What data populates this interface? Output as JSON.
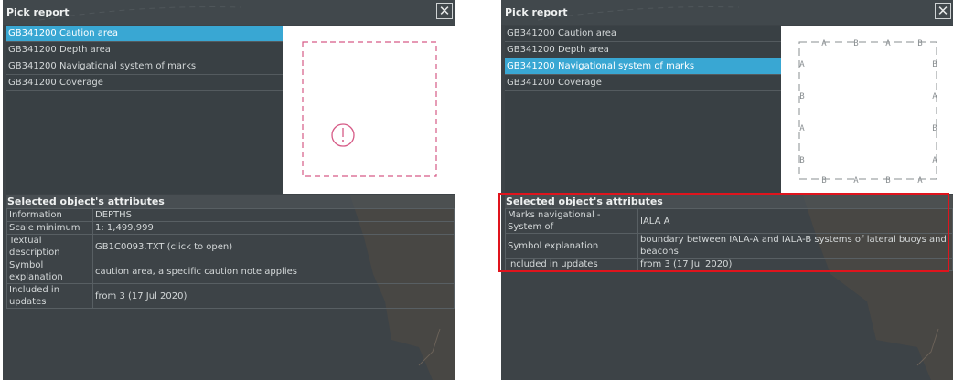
{
  "left": {
    "title": "Pick report",
    "close_icon": "close-icon",
    "items": [
      {
        "label": "GB341200 Caution area",
        "selected": true
      },
      {
        "label": "GB341200 Depth area",
        "selected": false
      },
      {
        "label": "GB341200 Navigational system of marks",
        "selected": false
      },
      {
        "label": "GB341200 Coverage",
        "selected": false
      }
    ],
    "preview_symbol": "caution-exclamation-icon",
    "attributes_title": "Selected object's attributes",
    "attributes": [
      {
        "name": "Information",
        "value": "DEPTHS"
      },
      {
        "name": "Scale minimum",
        "value": "1: 1,499,999"
      },
      {
        "name": "Textual description",
        "value": "GB1C0093.TXT (click to open)"
      },
      {
        "name": "Symbol explanation",
        "value": "caution area, a specific caution note applies"
      },
      {
        "name": "Included in updates",
        "value": "from 3 (17 Jul 2020)"
      }
    ]
  },
  "right": {
    "title": "Pick report",
    "close_icon": "close-icon",
    "items": [
      {
        "label": "GB341200 Caution area",
        "selected": false
      },
      {
        "label": "GB341200 Depth area",
        "selected": false
      },
      {
        "label": "GB341200 Navigational system of marks",
        "selected": true
      },
      {
        "label": "GB341200 Coverage",
        "selected": false
      }
    ],
    "preview_symbol": "iala-boundary-icon",
    "attributes_title": "Selected object's attributes",
    "attributes": [
      {
        "name": "Marks navigational - System of",
        "value": "IALA A"
      },
      {
        "name": "Symbol explanation",
        "value": "boundary between IALA-A and IALA-B systems of lateral buoys and beacons"
      },
      {
        "name": "Included in updates",
        "value": "from 3 (17 Jul 2020)"
      }
    ]
  },
  "colors": {
    "selection": "#39a7d3",
    "highlight_box": "#e0141d",
    "caution_symbol": "#d65a86"
  }
}
